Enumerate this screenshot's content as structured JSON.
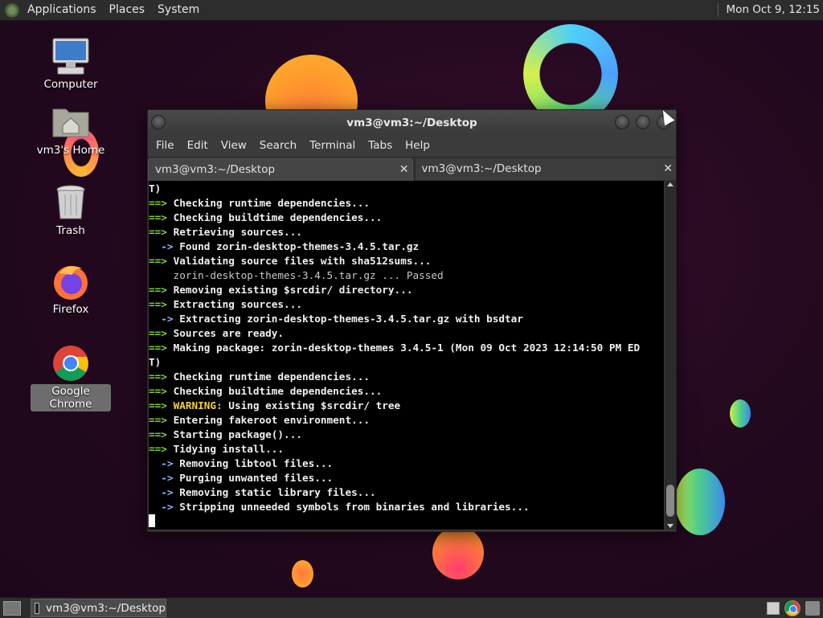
{
  "top_panel": {
    "menus": [
      "Applications",
      "Places",
      "System"
    ],
    "clock": "Mon Oct  9, 12:15"
  },
  "desktop_icons": [
    {
      "label": "Computer",
      "icon": "computer-icon"
    },
    {
      "label": "vm3's Home",
      "icon": "home-folder-icon"
    },
    {
      "label": "Trash",
      "icon": "trash-icon"
    },
    {
      "label": "Firefox",
      "icon": "firefox-icon"
    },
    {
      "label": "Google Chrome",
      "icon": "chrome-icon"
    }
  ],
  "terminal": {
    "title": "vm3@vm3:~/Desktop",
    "menu": [
      "File",
      "Edit",
      "View",
      "Search",
      "Terminal",
      "Tabs",
      "Help"
    ],
    "tabs": [
      {
        "label": "vm3@vm3:~/Desktop",
        "active": true
      },
      {
        "label": "vm3@vm3:~/Desktop",
        "active": false
      }
    ],
    "lines": [
      {
        "type": "plain-bold",
        "text": "T)"
      },
      {
        "type": "step",
        "text": "Checking runtime dependencies..."
      },
      {
        "type": "step",
        "text": "Checking buildtime dependencies..."
      },
      {
        "type": "step",
        "text": "Retrieving sources..."
      },
      {
        "type": "sub",
        "text": "Found zorin-desktop-themes-3.4.5.tar.gz"
      },
      {
        "type": "step",
        "text": "Validating source files with sha512sums..."
      },
      {
        "type": "plain",
        "text": "    zorin-desktop-themes-3.4.5.tar.gz ... Passed"
      },
      {
        "type": "step",
        "text": "Removing existing $srcdir/ directory..."
      },
      {
        "type": "step",
        "text": "Extracting sources..."
      },
      {
        "type": "sub",
        "text": "Extracting zorin-desktop-themes-3.4.5.tar.gz with bsdtar"
      },
      {
        "type": "step",
        "text": "Sources are ready."
      },
      {
        "type": "step",
        "text": "Making package: zorin-desktop-themes 3.4.5-1 (Mon 09 Oct 2023 12:14:50 PM ED"
      },
      {
        "type": "plain-bold",
        "text": "T)"
      },
      {
        "type": "step",
        "text": "Checking runtime dependencies..."
      },
      {
        "type": "step",
        "text": "Checking buildtime dependencies..."
      },
      {
        "type": "warning",
        "label": "WARNING:",
        "text": " Using existing $srcdir/ tree"
      },
      {
        "type": "step",
        "text": "Entering fakeroot environment..."
      },
      {
        "type": "step",
        "text": "Starting package()..."
      },
      {
        "type": "step",
        "text": "Tidying install..."
      },
      {
        "type": "sub",
        "text": "Removing libtool files..."
      },
      {
        "type": "sub",
        "text": "Purging unwanted files..."
      },
      {
        "type": "sub",
        "text": "Removing static library files..."
      },
      {
        "type": "sub",
        "text": "Stripping unneeded symbols from binaries and libraries..."
      }
    ],
    "step_prefix": "==> ",
    "sub_prefix": "  -> "
  },
  "taskbar": {
    "task_label": "vm3@vm3:~/Desktop"
  },
  "colors": {
    "step_arrow": "#7fd43a",
    "sub_arrow": "#8fb8ff",
    "warning": "#f2d03b"
  }
}
